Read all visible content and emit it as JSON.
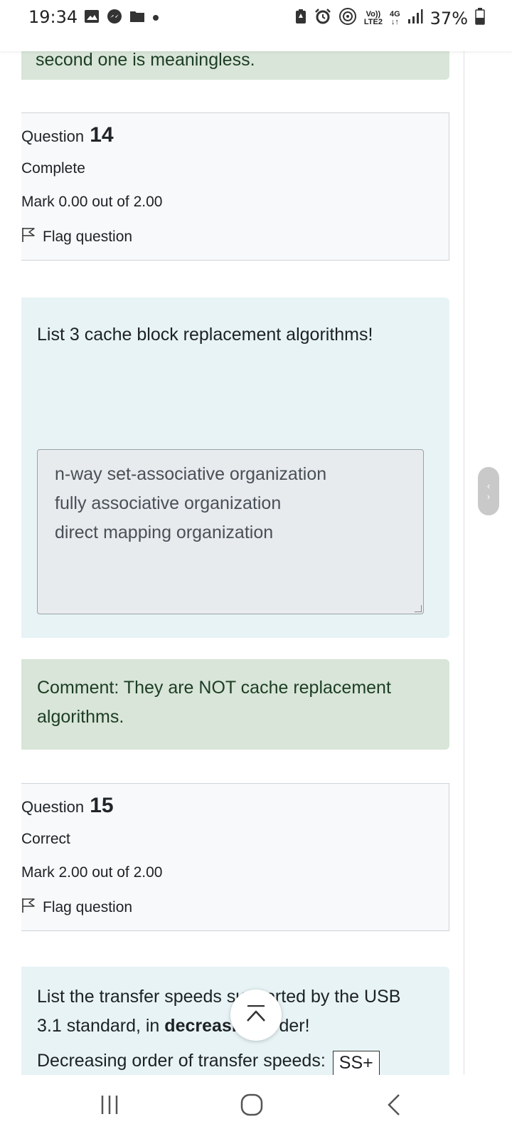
{
  "status_bar": {
    "time": "19:34",
    "left_icons": [
      "gallery-icon",
      "messenger-icon",
      "folder-icon",
      "dot-icon"
    ],
    "right_icons": [
      "battery-saver-icon",
      "alarm-icon",
      "hotspot-icon",
      "volte-icon",
      "4g-icon",
      "signal-icon",
      "battery-icon"
    ],
    "volte_top": "Vo))",
    "volte_bottom": "LTE2",
    "network": "4G",
    "battery": "37%"
  },
  "feedback_top": {
    "text": "second one is meaningless."
  },
  "questions": [
    {
      "label": "Question",
      "number": "14",
      "state": "Complete",
      "grade": "Mark 0.00 out of 2.00",
      "flag_label": "Flag question",
      "text": "List 3 cache block replacement algorithms!",
      "answer_lines": [
        "n-way set-associative organization",
        "fully associative organization",
        "direct mapping organization"
      ],
      "comment": "Comment: They are NOT cache replacement algorithms."
    },
    {
      "label": "Question",
      "number": "15",
      "state": "Correct",
      "grade": "Mark 2.00 out of 2.00",
      "flag_label": "Flag question",
      "text_before": "List the transfer speeds supported by the USB 3.1 standard, in ",
      "text_bold": "decreasing",
      "text_after": " order!",
      "order_label": "Decreasing order of transfer speeds:",
      "first_input_value": "SS+"
    }
  ],
  "nav": {
    "recent_apps": "recent-apps-icon",
    "home": "home-icon",
    "back": "back-icon"
  },
  "colors": {
    "feedback_bg": "#d8e5d8",
    "formulation_bg": "#e7f3f5",
    "info_bg": "#f8f9fa"
  }
}
